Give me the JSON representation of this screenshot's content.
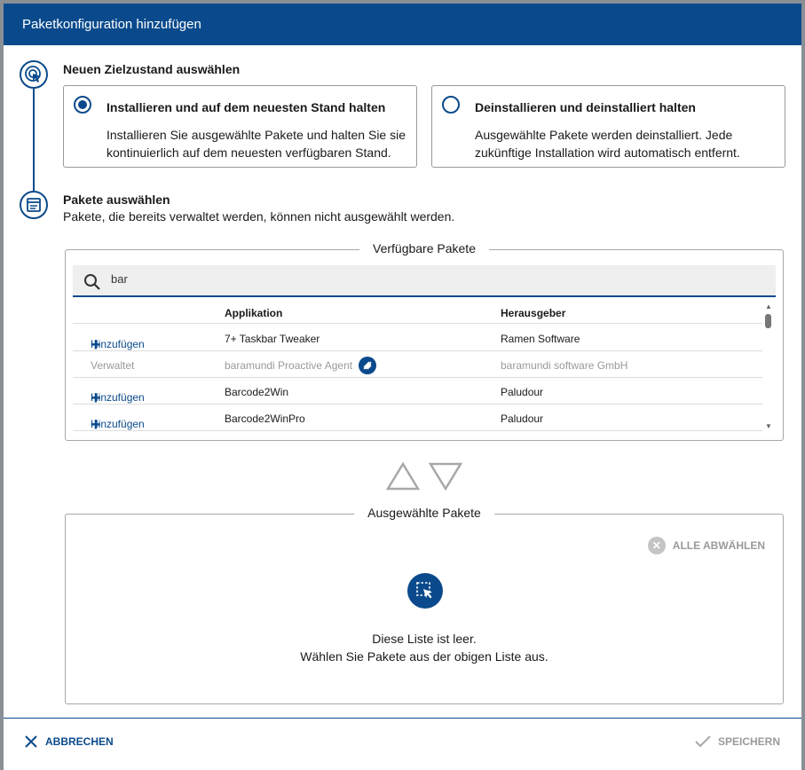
{
  "dialog": {
    "title": "Paketkonfiguration hinzufügen"
  },
  "step1": {
    "title": "Neuen Zielzustand auswählen",
    "options": [
      {
        "title": "Installieren und auf dem neuesten Stand halten",
        "line1": "Installieren Sie ausgewählte Pakete und halten Sie sie",
        "line2": "kontinuierlich auf dem neuesten verfügbaren Stand.",
        "selected": true
      },
      {
        "title": "Deinstallieren und deinstalliert halten",
        "line1": "Ausgewählte Pakete werden deinstalliert. Jede",
        "line2": "zukünftige Installation wird automatisch entfernt.",
        "selected": false
      }
    ]
  },
  "step2": {
    "title": "Pakete auswählen",
    "subtitle": "Pakete, die bereits verwaltet werden, können nicht ausgewählt werden."
  },
  "available": {
    "legend": "Verfügbare Pakete",
    "search_value": "bar",
    "columns": {
      "application": "Applikation",
      "publisher": "Herausgeber"
    },
    "rows": [
      {
        "action": "Hinzufügen",
        "application": "7+ Taskbar Tweaker",
        "publisher": "Ramen Software",
        "managed": false
      },
      {
        "action": "Verwaltet",
        "application": "baramundi Proactive Agent",
        "publisher": "baramundi software GmbH",
        "managed": true
      },
      {
        "action": "Hinzufügen",
        "application": "Barcode2Win",
        "publisher": "Paludour",
        "managed": false
      },
      {
        "action": "Hinzufügen",
        "application": "Barcode2WinPro",
        "publisher": "Paludour",
        "managed": false
      }
    ]
  },
  "selected": {
    "legend": "Ausgewählte Pakete",
    "clear_all": "ALLE ABWÄHLEN",
    "empty_line1": "Diese Liste ist leer.",
    "empty_line2": "Wählen Sie Pakete aus der obigen Liste aus."
  },
  "footer": {
    "cancel": "ABBRECHEN",
    "save": "SPEICHERN"
  },
  "colors": {
    "primary": "#0a4a8c",
    "muted": "#9a9a9a"
  }
}
